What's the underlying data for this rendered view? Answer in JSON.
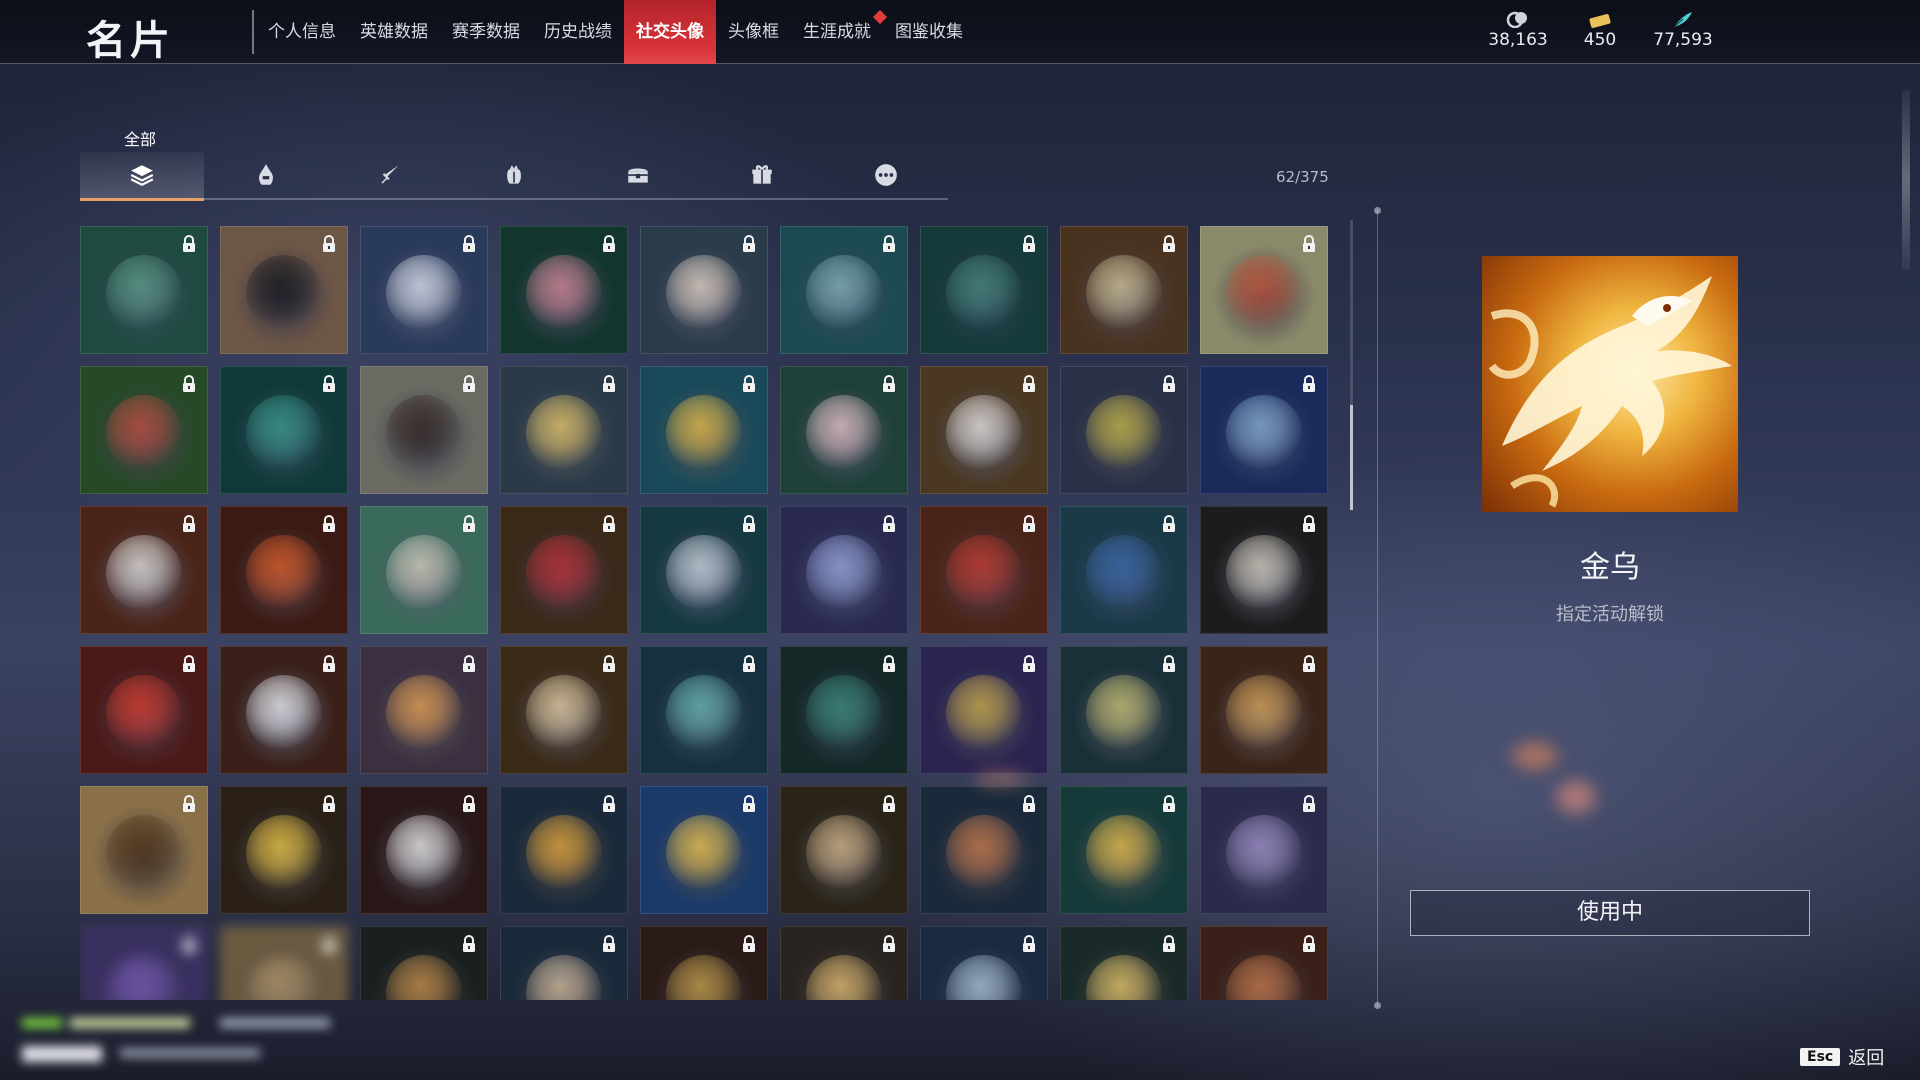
{
  "page_title": "名片",
  "nav": {
    "tabs": [
      {
        "label": "个人信息"
      },
      {
        "label": "英雄数据"
      },
      {
        "label": "赛季数据"
      },
      {
        "label": "历史战绩"
      },
      {
        "label": "社交头像",
        "active": true
      },
      {
        "label": "头像框"
      },
      {
        "label": "生涯成就",
        "badge": true
      },
      {
        "label": "图鉴收集"
      }
    ]
  },
  "currencies": [
    {
      "icon": "coin-icon",
      "value": "38,163",
      "color": "#cfd3dd"
    },
    {
      "icon": "ticket-icon",
      "value": "450",
      "color": "#e9c25a"
    },
    {
      "icon": "feather-icon",
      "value": "77,593",
      "color": "#4fd0d8"
    }
  ],
  "categories": {
    "active_label": "全部",
    "items": [
      {
        "icon": "layers-icon",
        "active": true
      },
      {
        "icon": "helmet-icon"
      },
      {
        "icon": "sword-icon"
      },
      {
        "icon": "pouch-icon"
      },
      {
        "icon": "chest-icon"
      },
      {
        "icon": "gift-icon"
      },
      {
        "icon": "more-icon"
      }
    ]
  },
  "collection_count": "62/375",
  "grid": {
    "tiles": [
      {
        "bg": "#1f4a40",
        "accent": "#5fa08a",
        "locked": true
      },
      {
        "bg": "#6e5646",
        "accent": "#1a1a1a",
        "locked": true
      },
      {
        "bg": "#2a3a5a",
        "accent": "#dfe4f0",
        "locked": true
      },
      {
        "bg": "#12352e",
        "accent": "#d48a96",
        "locked": true
      },
      {
        "bg": "#2a3b4a",
        "accent": "#e8d8c8",
        "locked": true
      },
      {
        "bg": "#1c4a52",
        "accent": "#88b8c0",
        "locked": true
      },
      {
        "bg": "#163a3a",
        "accent": "#4a8a80",
        "locked": true
      },
      {
        "bg": "#4a3220",
        "accent": "#d8c89a",
        "locked": true
      },
      {
        "bg": "#8a8a6a",
        "accent": "#c85a3a",
        "locked": true
      },
      {
        "bg": "#264a28",
        "accent": "#c0503a",
        "locked": true
      },
      {
        "bg": "#103a38",
        "accent": "#3a9a8a",
        "locked": true
      },
      {
        "bg": "#6a6a62",
        "accent": "#3a2a20",
        "locked": true
      },
      {
        "bg": "#2a3a48",
        "accent": "#e8c868",
        "locked": true
      },
      {
        "bg": "#1a4a5a",
        "accent": "#e8c048",
        "locked": true
      },
      {
        "bg": "#1e4038",
        "accent": "#e8c8c8",
        "locked": true
      },
      {
        "bg": "#4a3822",
        "accent": "#f0e8e0",
        "locked": true
      },
      {
        "bg": "#2a3048",
        "accent": "#c8b848",
        "locked": true
      },
      {
        "bg": "#1a2a5a",
        "accent": "#8ab0d8",
        "locked": true
      },
      {
        "bg": "#4a2418",
        "accent": "#e8e0d8",
        "locked": true
      },
      {
        "bg": "#3a1a12",
        "accent": "#e05a20",
        "locked": true
      },
      {
        "bg": "#3a6a5a",
        "accent": "#d8d4c0",
        "locked": true
      },
      {
        "bg": "#3a2818",
        "accent": "#c03030",
        "locked": true
      },
      {
        "bg": "#163840",
        "accent": "#d0d8e0",
        "locked": true
      },
      {
        "bg": "#2a2a50",
        "accent": "#9aa8e0",
        "locked": true
      },
      {
        "bg": "#4a2418",
        "accent": "#c83a2a",
        "locked": true
      },
      {
        "bg": "#1a3a48",
        "accent": "#3a6aa8",
        "locked": true
      },
      {
        "bg": "#1c1c1c",
        "accent": "#d8d0c0",
        "locked": true
      },
      {
        "bg": "#4a1a18",
        "accent": "#d83a2a",
        "locked": true
      },
      {
        "bg": "#3a2018",
        "accent": "#f0f0f0",
        "locked": true
      },
      {
        "bg": "#3a3040",
        "accent": "#e8a050",
        "locked": true
      },
      {
        "bg": "#3a2a18",
        "accent": "#e8d0a0",
        "locked": true
      },
      {
        "bg": "#163040",
        "accent": "#6ab8b0",
        "locked": true
      },
      {
        "bg": "#142828",
        "accent": "#3a8a78",
        "locked": true
      },
      {
        "bg": "#2a2450",
        "accent": "#c8a848",
        "locked": true
      },
      {
        "bg": "#1a3038",
        "accent": "#c8c070",
        "locked": true
      },
      {
        "bg": "#3a2418",
        "accent": "#d8a050",
        "locked": true
      },
      {
        "bg": "#8a7048",
        "accent": "#5a3a18",
        "locked": true
      },
      {
        "bg": "#2a2018",
        "accent": "#f0c840",
        "locked": true
      },
      {
        "bg": "#2a1818",
        "accent": "#f0ece8",
        "locked": true
      },
      {
        "bg": "#1a2a3a",
        "accent": "#e8a838",
        "locked": true
      },
      {
        "bg": "#1a3a6a",
        "accent": "#f0c850",
        "locked": true
      },
      {
        "bg": "#2a2418",
        "accent": "#d8b888",
        "locked": true
      },
      {
        "bg": "#1a2a3a",
        "accent": "#c87a48",
        "locked": true
      },
      {
        "bg": "#163a3a",
        "accent": "#e8c048",
        "locked": true
      },
      {
        "bg": "#2a2a4a",
        "accent": "#a090c8",
        "locked": true
      },
      {
        "bg": "#3a3060",
        "accent": "#8060c0",
        "locked": true,
        "blur": true
      },
      {
        "bg": "#6a5a40",
        "accent": "#c0a070",
        "locked": true,
        "blur": true
      },
      {
        "bg": "#1a2020",
        "accent": "#c89048",
        "locked": true
      },
      {
        "bg": "#1a2a3a",
        "accent": "#d8c0a0",
        "locked": true
      },
      {
        "bg": "#2a1a18",
        "accent": "#c8a048",
        "locked": true
      },
      {
        "bg": "#2a2420",
        "accent": "#e8c070",
        "locked": true
      },
      {
        "bg": "#1a2a40",
        "accent": "#b0c8e0",
        "locked": true
      },
      {
        "bg": "#1a2a28",
        "accent": "#e8c868",
        "locked": true
      },
      {
        "bg": "#3a2018",
        "accent": "#c87848",
        "locked": true
      }
    ]
  },
  "detail": {
    "name": "金乌",
    "subtitle": "指定活动解锁",
    "button_label": "使用中"
  },
  "footer": {
    "esc_key": "Esc",
    "back_label": "返回"
  }
}
